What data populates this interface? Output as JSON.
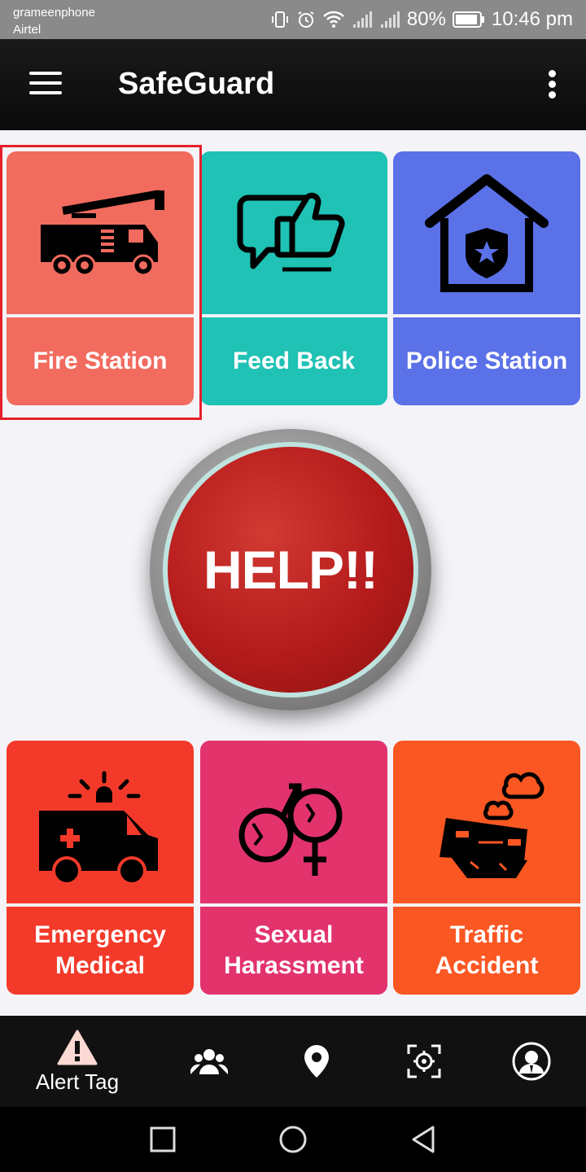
{
  "status": {
    "carrier1": "grameenphone",
    "carrier2": "Airtel",
    "battery": "80%",
    "time": "10:46 pm"
  },
  "appbar": {
    "title": "SafeGuard"
  },
  "tiles": {
    "fire": {
      "label": "Fire Station",
      "color": "#f26b5f"
    },
    "feedback": {
      "label": "Feed Back",
      "color": "#1fc2b4"
    },
    "police": {
      "label": "Police Station",
      "color": "#5b71e8"
    },
    "medical": {
      "label": "Emergency\nMedical",
      "color": "#f33a2a"
    },
    "harassment": {
      "label": "Sexual\nHarassment",
      "color": "#e2336d"
    },
    "traffic": {
      "label": "Traffic\nAccident",
      "color": "#fb5722"
    }
  },
  "help": {
    "label": "HELP!!"
  },
  "bottomnav": {
    "alert_label": "Alert Tag",
    "icons": [
      "alert-icon",
      "group-icon",
      "location-pin-icon",
      "gps-target-icon",
      "profile-icon"
    ]
  }
}
